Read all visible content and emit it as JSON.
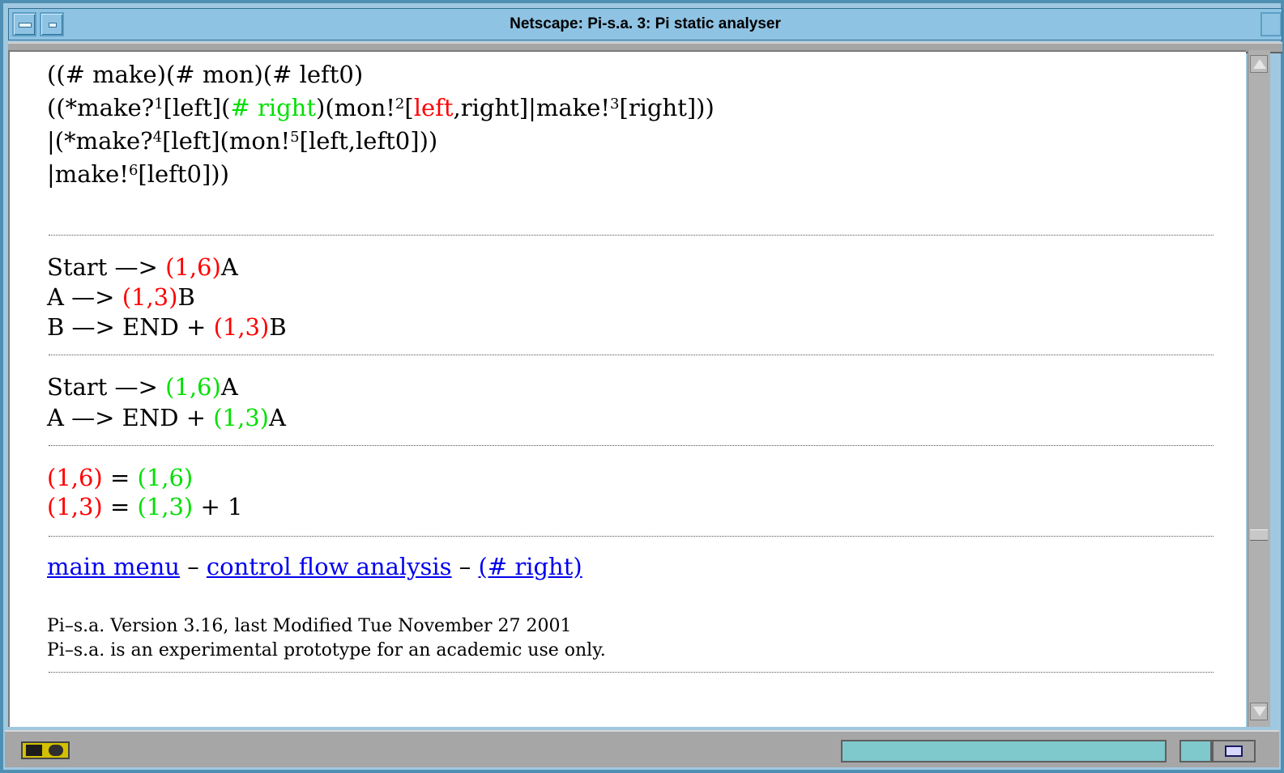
{
  "window": {
    "title": "Netscape: Pi-s.a. 3: Pi static analyser"
  },
  "process": {
    "line1": "((# make)(# mon)(# left0)",
    "line2": {
      "p1": "((*make?",
      "s1": "1",
      "p2": "[left](",
      "g1": "# right",
      "p3": ")(mon!",
      "s2": "2",
      "p4": "[",
      "r1": "left",
      "p5": ",right]|make!",
      "s3": "3",
      "p6": "[right]))"
    },
    "line3": {
      "p1": "|(*make?",
      "s1": "4",
      "p2": "[left](mon!",
      "s2": "5",
      "p3": "[left,left0]))"
    },
    "line4": {
      "p1": "|make!",
      "s1": "6",
      "p2": "[left0]))"
    }
  },
  "grammar_red": {
    "r1": {
      "lhs": "Start —> ",
      "pair": "(1,6)",
      "rhs": "A"
    },
    "r2": {
      "lhs": "A —> ",
      "pair": "(1,3)",
      "rhs": "B"
    },
    "r3": {
      "lhs": "B —> END + ",
      "pair": "(1,3)",
      "rhs": "B"
    }
  },
  "grammar_green": {
    "r1": {
      "lhs": "Start —> ",
      "pair": "(1,6)",
      "rhs": "A"
    },
    "r2": {
      "lhs": "A —> END + ",
      "pair": "(1,3)",
      "rhs": "A"
    }
  },
  "equations": {
    "e1": {
      "left": "(1,6)",
      "eq": " = ",
      "right": "(1,6)"
    },
    "e2": {
      "left": "(1,3)",
      "eq": " = ",
      "right": "(1,3)",
      "tail": " + 1"
    }
  },
  "nav": {
    "main_menu": "main menu",
    "sep1": " – ",
    "cfa": "control flow analysis",
    "sep2": " – ",
    "right": "(# right)"
  },
  "footer": {
    "line1": "Pi–s.a. Version 3.16, last Modified Tue November 27 2001",
    "line2": "Pi–s.a. is an experimental prototype for an academic use only."
  },
  "colors": {
    "red": "#ff0000",
    "green": "#00e000",
    "link": "#0000ee",
    "title_bar": "#8fc3e3"
  },
  "icons": {
    "status": "security-status-icon",
    "mail": "mail-icon"
  }
}
